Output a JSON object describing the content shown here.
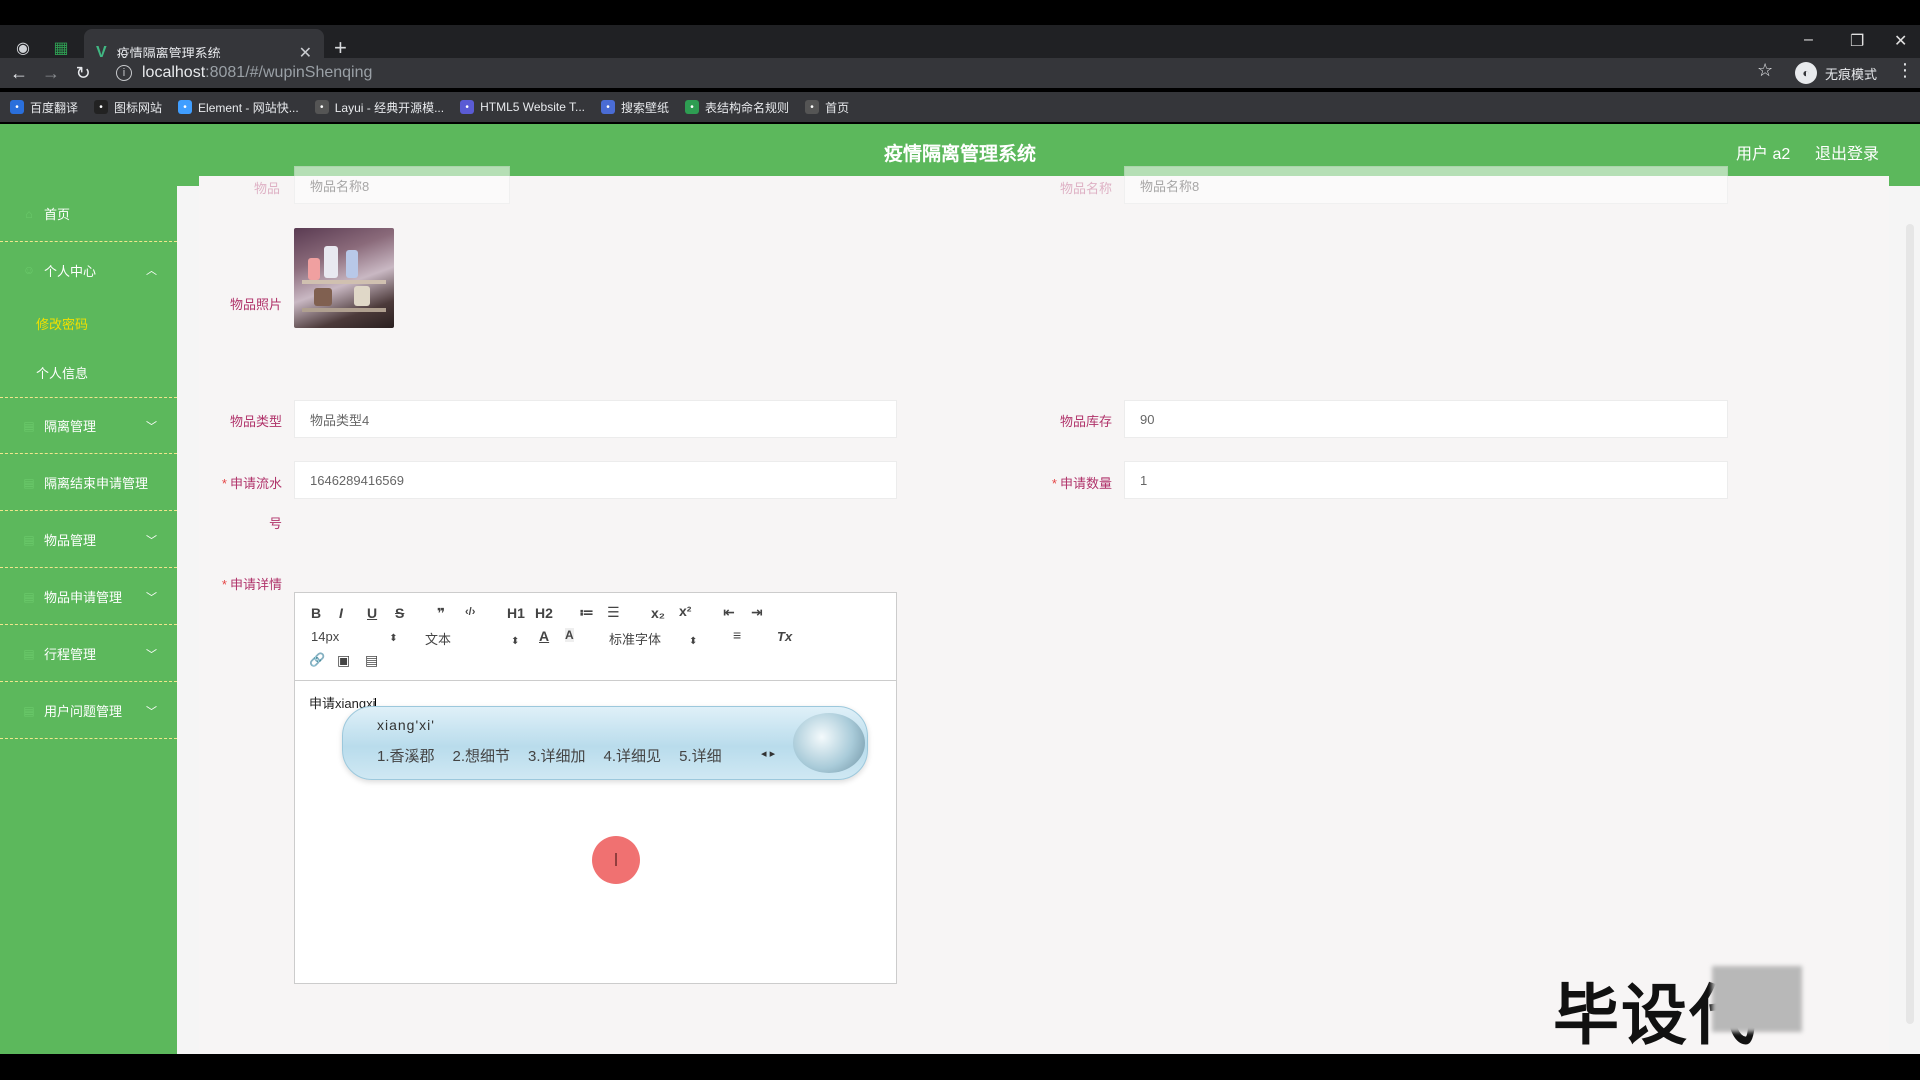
{
  "browser": {
    "tab_title": "疫情隔离管理系统",
    "url_host": "localhost",
    "url_path": ":8081/#/wupinShenqing",
    "incognito_label": "无痕模式",
    "bookmarks": [
      {
        "label": "百度翻译",
        "color": "#2a6fdb",
        "icon": "translate-icon"
      },
      {
        "label": "图标网站",
        "color": "#222222",
        "icon": "flag-icon"
      },
      {
        "label": "Element - 网站快...",
        "color": "#409eff",
        "icon": "element-icon"
      },
      {
        "label": "Layui - 经典开源模...",
        "color": "#555555",
        "icon": "layui-icon"
      },
      {
        "label": "HTML5 Website T...",
        "color": "#5a5bd4",
        "icon": "html5-icon"
      },
      {
        "label": "搜索壁纸",
        "color": "#4a6cd4",
        "icon": "wallpaper-icon"
      },
      {
        "label": "表结构命名规则",
        "color": "#2e9d52",
        "icon": "table-icon"
      },
      {
        "label": "首页",
        "color": "#555555",
        "icon": "home-globe-icon"
      }
    ]
  },
  "header": {
    "title": "疫情隔离管理系统",
    "user_label": "用户 a2",
    "logout_label": "退出登录"
  },
  "sidebar": {
    "items": [
      {
        "label": "首页"
      },
      {
        "label": "个人中心"
      },
      {
        "label": "修改密码"
      },
      {
        "label": "个人信息"
      },
      {
        "label": "隔离管理"
      },
      {
        "label": "隔离结束申请管理"
      },
      {
        "label": "物品管理"
      },
      {
        "label": "物品申请管理"
      },
      {
        "label": "行程管理"
      },
      {
        "label": "用户问题管理"
      }
    ]
  },
  "form": {
    "top_left_label": "物品",
    "top_left_value": "物品名称8",
    "top_right_label": "物品名称",
    "top_right_value": "物品名称8",
    "photo_label": "物品照片",
    "type_label": "物品类型",
    "type_value": "物品类型4",
    "stock_label": "物品库存",
    "stock_value": "90",
    "serial_label": "申请流水",
    "serial_label_2": "号",
    "serial_value": "1646289416569",
    "quantity_label": "申请数量",
    "quantity_value": "1",
    "detail_label": "申请详情"
  },
  "editor": {
    "toolbar": {
      "bold": "B",
      "italic": "I",
      "underline": "U",
      "strike": "S",
      "quote": "❞",
      "code": "‹/›",
      "h1": "H1",
      "h2": "H2",
      "ol": "≔",
      "ul": "☰",
      "sub": "x₂",
      "sup": "x²",
      "outdent": "⇤",
      "indent": "⇥",
      "size": "14px",
      "format": "文本",
      "font": "标准字体",
      "color": "A",
      "bg": "A",
      "align": "≡",
      "clean": "Tx",
      "link": "🔗",
      "image": "▣",
      "video": "▤"
    },
    "content": "申请xiangxi"
  },
  "ime": {
    "composition": "xiang'xi'",
    "candidates": [
      "1.香溪郡",
      "2.想细节",
      "3.详细加",
      "4.详细见",
      "5.详细"
    ]
  },
  "watermark": {
    "text": "毕设代"
  }
}
